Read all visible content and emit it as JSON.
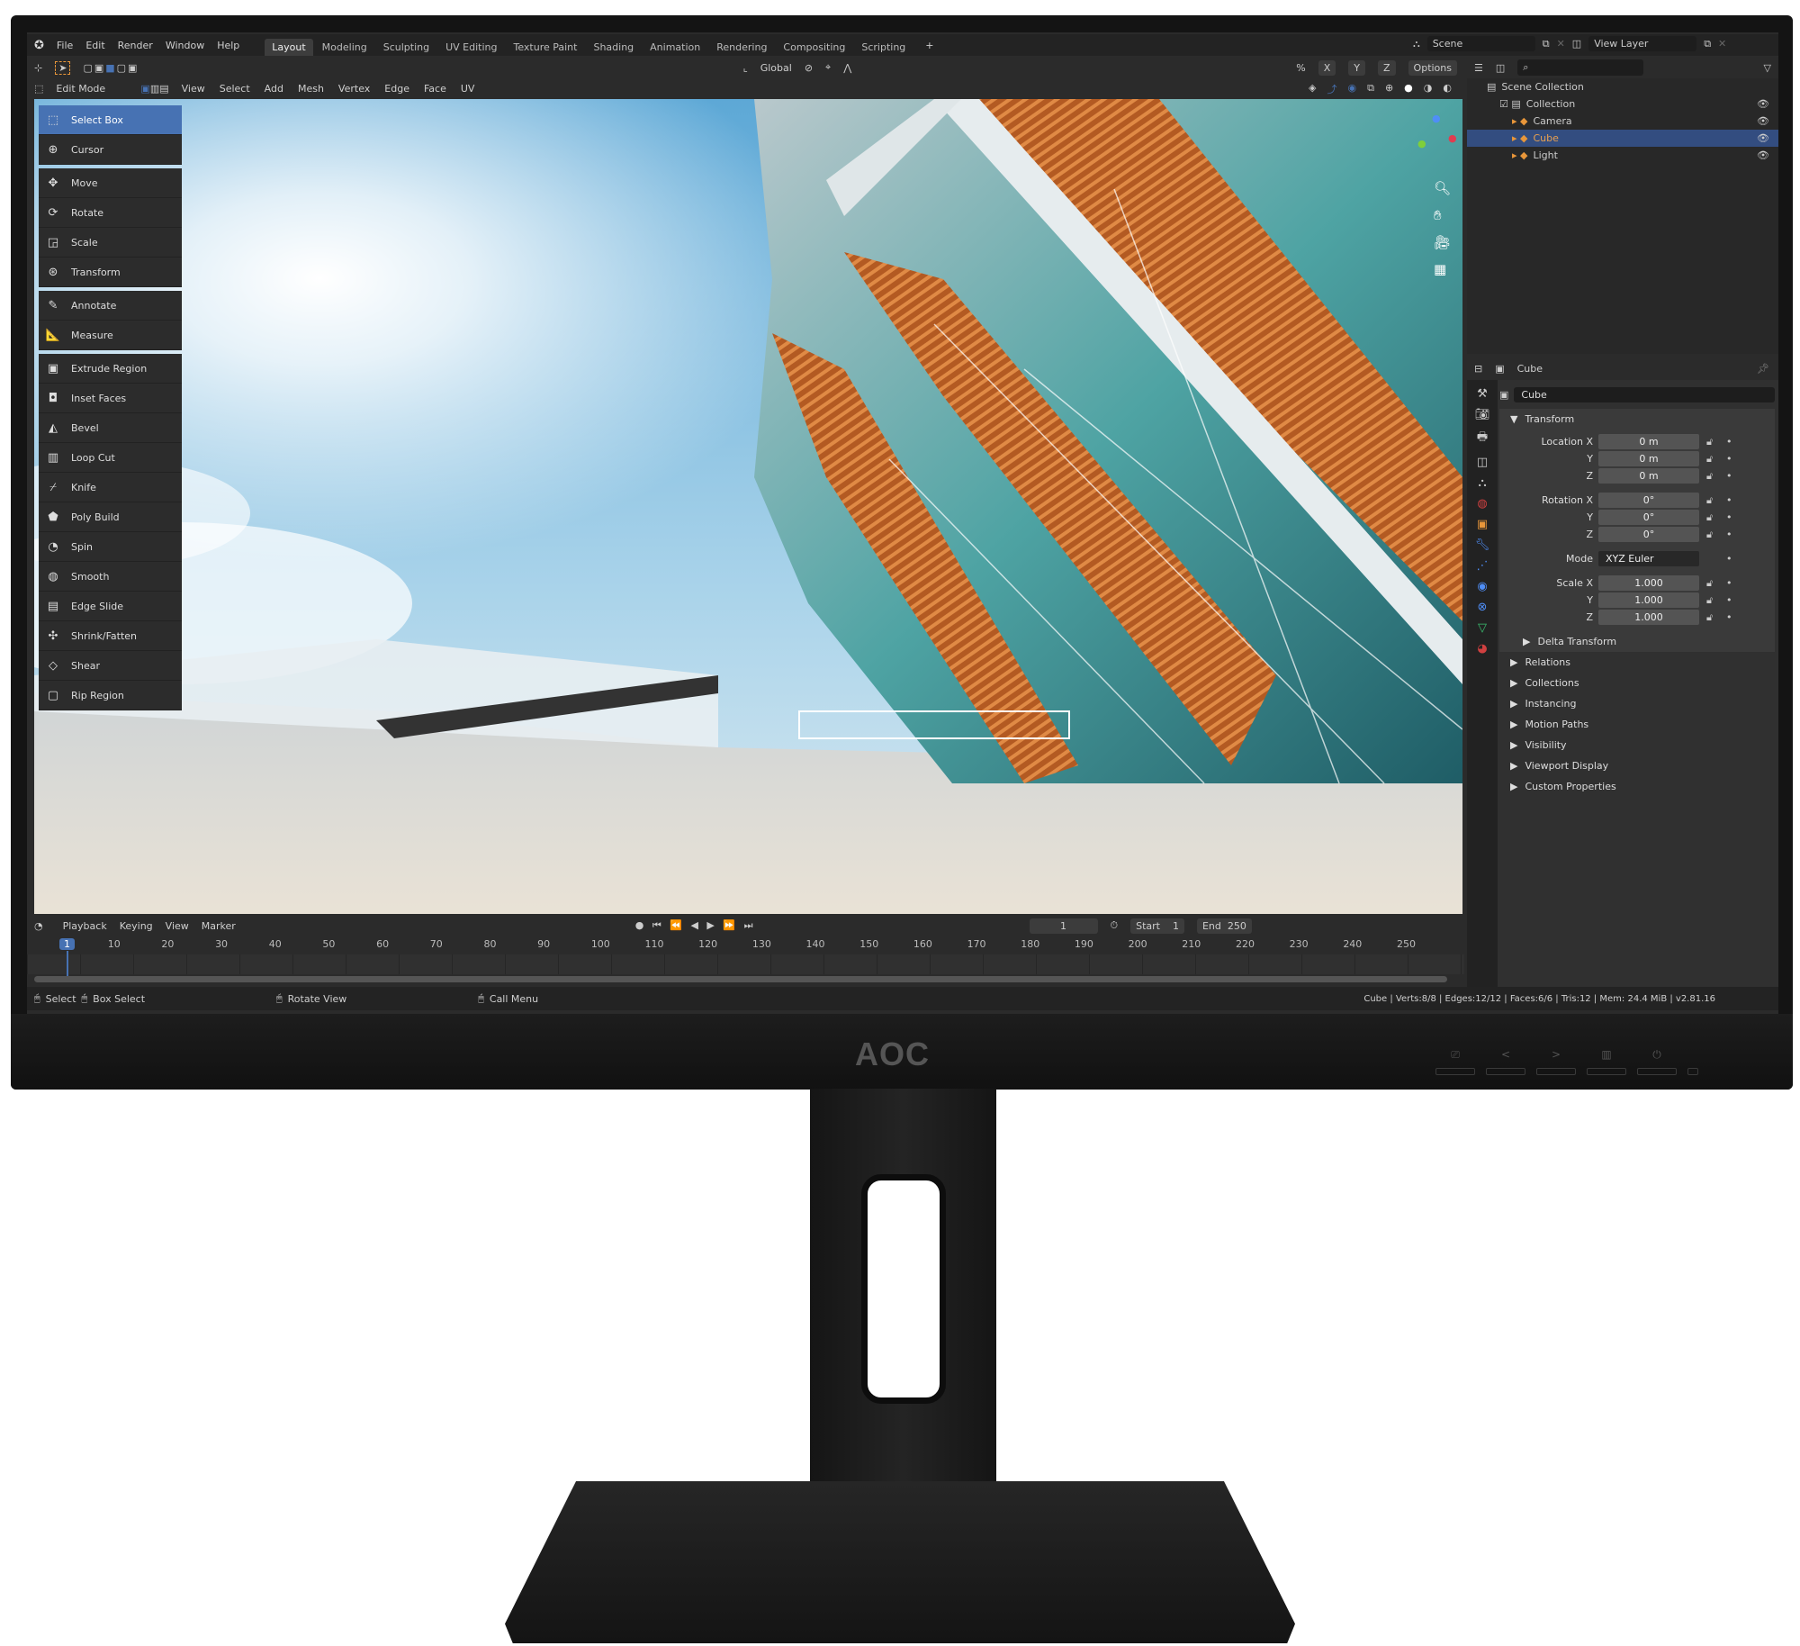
{
  "menu": {
    "items": [
      "File",
      "Edit",
      "Render",
      "Window",
      "Help"
    ]
  },
  "workspaces": [
    {
      "label": "Layout",
      "active": true
    },
    {
      "label": "Modeling"
    },
    {
      "label": "Sculpting"
    },
    {
      "label": "UV Editing"
    },
    {
      "label": "Texture Paint"
    },
    {
      "label": "Shading"
    },
    {
      "label": "Animation"
    },
    {
      "label": "Rendering"
    },
    {
      "label": "Compositing"
    },
    {
      "label": "Scripting"
    }
  ],
  "add_workspace": "+",
  "scene": {
    "label": "Scene",
    "view_layer": "View Layer"
  },
  "header": {
    "transform_orientation": "Global",
    "options": "Options",
    "axes": [
      "X",
      "Y",
      "Z"
    ]
  },
  "mode_bar": {
    "mode": "Edit Mode",
    "menus": [
      "View",
      "Select",
      "Add",
      "Mesh",
      "Vertex",
      "Edge",
      "Face",
      "UV"
    ]
  },
  "tools": [
    {
      "label": "Select Box",
      "icon": "select-box-icon",
      "active": true,
      "glyph": "⬚"
    },
    {
      "label": "Cursor",
      "icon": "cursor-icon",
      "glyph": "⊕"
    },
    {
      "label": "Move",
      "icon": "move-icon",
      "glyph": "✥",
      "gap": true
    },
    {
      "label": "Rotate",
      "icon": "rotate-icon",
      "glyph": "⟳"
    },
    {
      "label": "Scale",
      "icon": "scale-icon",
      "glyph": "◲"
    },
    {
      "label": "Transform",
      "icon": "transform-icon",
      "glyph": "⊛"
    },
    {
      "label": "Annotate",
      "icon": "annotate-icon",
      "glyph": "✎",
      "gap": true
    },
    {
      "label": "Measure",
      "icon": "measure-icon",
      "glyph": "📐"
    },
    {
      "label": "Extrude Region",
      "icon": "extrude-region-icon",
      "glyph": "▣",
      "gap": true
    },
    {
      "label": "Inset Faces",
      "icon": "inset-faces-icon",
      "glyph": "◘"
    },
    {
      "label": "Bevel",
      "icon": "bevel-icon",
      "glyph": "◭"
    },
    {
      "label": "Loop Cut",
      "icon": "loop-cut-icon",
      "glyph": "▥"
    },
    {
      "label": "Knife",
      "icon": "knife-icon",
      "glyph": "⌿"
    },
    {
      "label": "Poly Build",
      "icon": "poly-build-icon",
      "glyph": "⬟"
    },
    {
      "label": "Spin",
      "icon": "spin-icon",
      "glyph": "◔"
    },
    {
      "label": "Smooth",
      "icon": "smooth-icon",
      "glyph": "◍"
    },
    {
      "label": "Edge Slide",
      "icon": "edge-slide-icon",
      "glyph": "▤"
    },
    {
      "label": "Shrink/Fatten",
      "icon": "shrink-fatten-icon",
      "glyph": "✣"
    },
    {
      "label": "Shear",
      "icon": "shear-icon",
      "glyph": "◇"
    },
    {
      "label": "Rip Region",
      "icon": "rip-region-icon",
      "glyph": "▢"
    }
  ],
  "outliner": {
    "root": "Scene Collection",
    "items": [
      {
        "label": "Collection",
        "depth": 1,
        "icon": "collection-icon"
      },
      {
        "label": "Camera",
        "depth": 2,
        "icon": "camera-icon",
        "color": "#e8963a"
      },
      {
        "label": "Cube",
        "depth": 2,
        "icon": "mesh-icon",
        "color": "#e8963a",
        "selected": true
      },
      {
        "label": "Light",
        "depth": 2,
        "icon": "light-icon",
        "color": "#e8963a"
      }
    ]
  },
  "properties": {
    "object_name": "Cube",
    "data_name": "Cube",
    "transform_label": "Transform",
    "rows": [
      {
        "label": "Location X",
        "value": "0 m"
      },
      {
        "label": "Y",
        "value": "0 m"
      },
      {
        "label": "Z",
        "value": "0 m"
      },
      {
        "label": "Rotation X",
        "value": "0°",
        "gap": true
      },
      {
        "label": "Y",
        "value": "0°"
      },
      {
        "label": "Z",
        "value": "0°"
      },
      {
        "label": "Mode",
        "value": "XYZ Euler",
        "gap": true,
        "dropdown": true
      },
      {
        "label": "Scale X",
        "value": "1.000",
        "gap": true
      },
      {
        "label": "Y",
        "value": "1.000"
      },
      {
        "label": "Z",
        "value": "1.000"
      }
    ],
    "delta": "Delta Transform",
    "sections": [
      "Relations",
      "Collections",
      "Instancing",
      "Motion Paths",
      "Visibility",
      "Viewport Display",
      "Custom Properties"
    ]
  },
  "timeline": {
    "menus": [
      "Playback",
      "Keying",
      "View",
      "Marker"
    ],
    "current_frame": "1",
    "start_label": "Start",
    "start": "1",
    "end_label": "End",
    "end": "250",
    "ticks": [
      "1",
      "10",
      "20",
      "30",
      "40",
      "50",
      "60",
      "70",
      "80",
      "90",
      "100",
      "110",
      "120",
      "130",
      "140",
      "150",
      "160",
      "170",
      "180",
      "190",
      "200",
      "210",
      "220",
      "230",
      "240",
      "250"
    ]
  },
  "statusbar": {
    "hints": [
      "Select",
      "Box Select",
      "Rotate View",
      "Call Menu"
    ],
    "stats": "Cube | Verts:8/8 | Edges:12/12 | Faces:6/6 | Tris:12 | Mem: 24.4 MiB | v2.81.16"
  },
  "monitor": {
    "brand": "AOC",
    "buttons": [
      "⎚",
      "<",
      ">",
      "▥",
      "⏻"
    ]
  },
  "colors": {
    "accent": "#4772b3",
    "selected_row": "#334d80",
    "bg": "#2b2b2b"
  }
}
